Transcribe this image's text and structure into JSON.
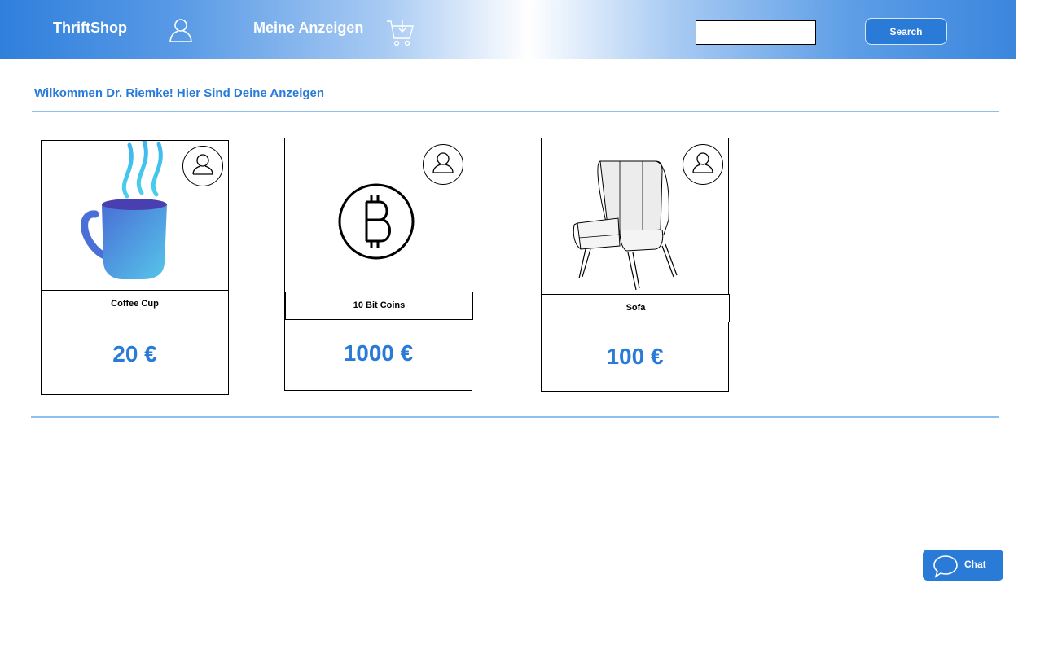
{
  "header": {
    "brand": "ThriftShop",
    "nav_my_ads": "Meine Anzeigen",
    "search_placeholder": "",
    "search_label": "Search"
  },
  "main": {
    "welcome": "Wilkommen Dr. Riemke! Hier Sind Deine Anzeigen",
    "listings": [
      {
        "title": "Coffee Cup",
        "price": "20 €",
        "image": "coffee-cup"
      },
      {
        "title": "10 Bit Coins",
        "price": "1000 €",
        "image": "bitcoin"
      },
      {
        "title": "Sofa",
        "price": "100 €",
        "image": "armchair"
      }
    ]
  },
  "chat": {
    "label": "Chat"
  },
  "colors": {
    "accent": "#2a7ad8",
    "divider": "#8fbfee"
  }
}
